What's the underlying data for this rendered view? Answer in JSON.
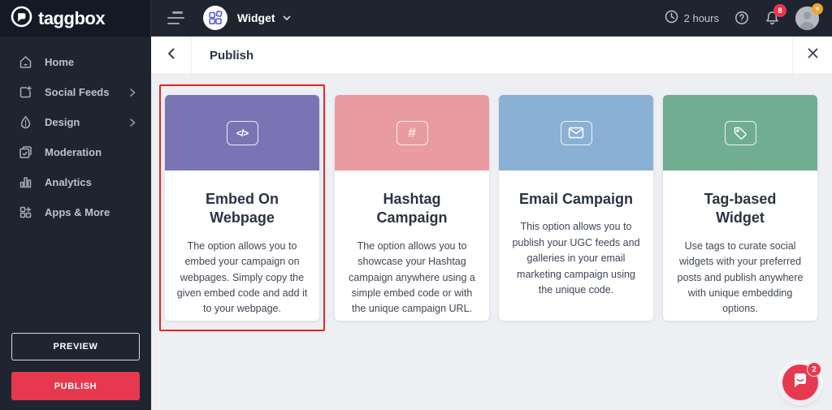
{
  "topbar": {
    "logo_text": "taggbox",
    "widget": {
      "label": "Widget"
    },
    "session_time": "2 hours",
    "notifications": {
      "count": "8"
    }
  },
  "sidebar": {
    "items": [
      {
        "label": "Home",
        "icon": "home-icon",
        "has_submenu": false
      },
      {
        "label": "Social Feeds",
        "icon": "social-feeds-icon",
        "has_submenu": true
      },
      {
        "label": "Design",
        "icon": "design-icon",
        "has_submenu": true
      },
      {
        "label": "Moderation",
        "icon": "moderation-icon",
        "has_submenu": false
      },
      {
        "label": "Analytics",
        "icon": "analytics-icon",
        "has_submenu": false
      },
      {
        "label": "Apps & More",
        "icon": "apps-more-icon",
        "has_submenu": false
      }
    ],
    "preview_label": "PREVIEW",
    "publish_label": "PUBLISH"
  },
  "panel": {
    "title": "Publish"
  },
  "cards": [
    {
      "title": "Embed On Webpage",
      "description": "The option allows you to embed your campaign on webpages. Simply copy the given embed code and add it to your webpage.",
      "header_color": "#7b74b4",
      "icon": "code-icon",
      "icon_glyph": "</>",
      "selected": true
    },
    {
      "title": "Hashtag Campaign",
      "description": "The option allows you to showcase your Hashtag campaign anywhere using a simple embed code or with the unique campaign URL.",
      "header_color": "#ea9ba0",
      "icon": "hashtag-icon",
      "icon_glyph": "#",
      "selected": false
    },
    {
      "title": "Email Campaign",
      "description": "This option allows you to publish your UGC feeds and galleries in your email marketing campaign using the unique code.",
      "header_color": "#8ab0d3",
      "icon": "email-icon",
      "selected": false
    },
    {
      "title": "Tag-based Widget",
      "description": "Use tags to curate social widgets with your preferred posts and publish anywhere with unique embedding options.",
      "header_color": "#71ad90",
      "icon": "tag-icon",
      "selected": false
    }
  ],
  "chat": {
    "badge_count": "2"
  },
  "colors": {
    "accent_red": "#e6394f",
    "selection_border": "#e0281e",
    "topbar_bg": "#1e2531",
    "logo_bg": "#131a26",
    "main_bg": "#edeff3"
  }
}
